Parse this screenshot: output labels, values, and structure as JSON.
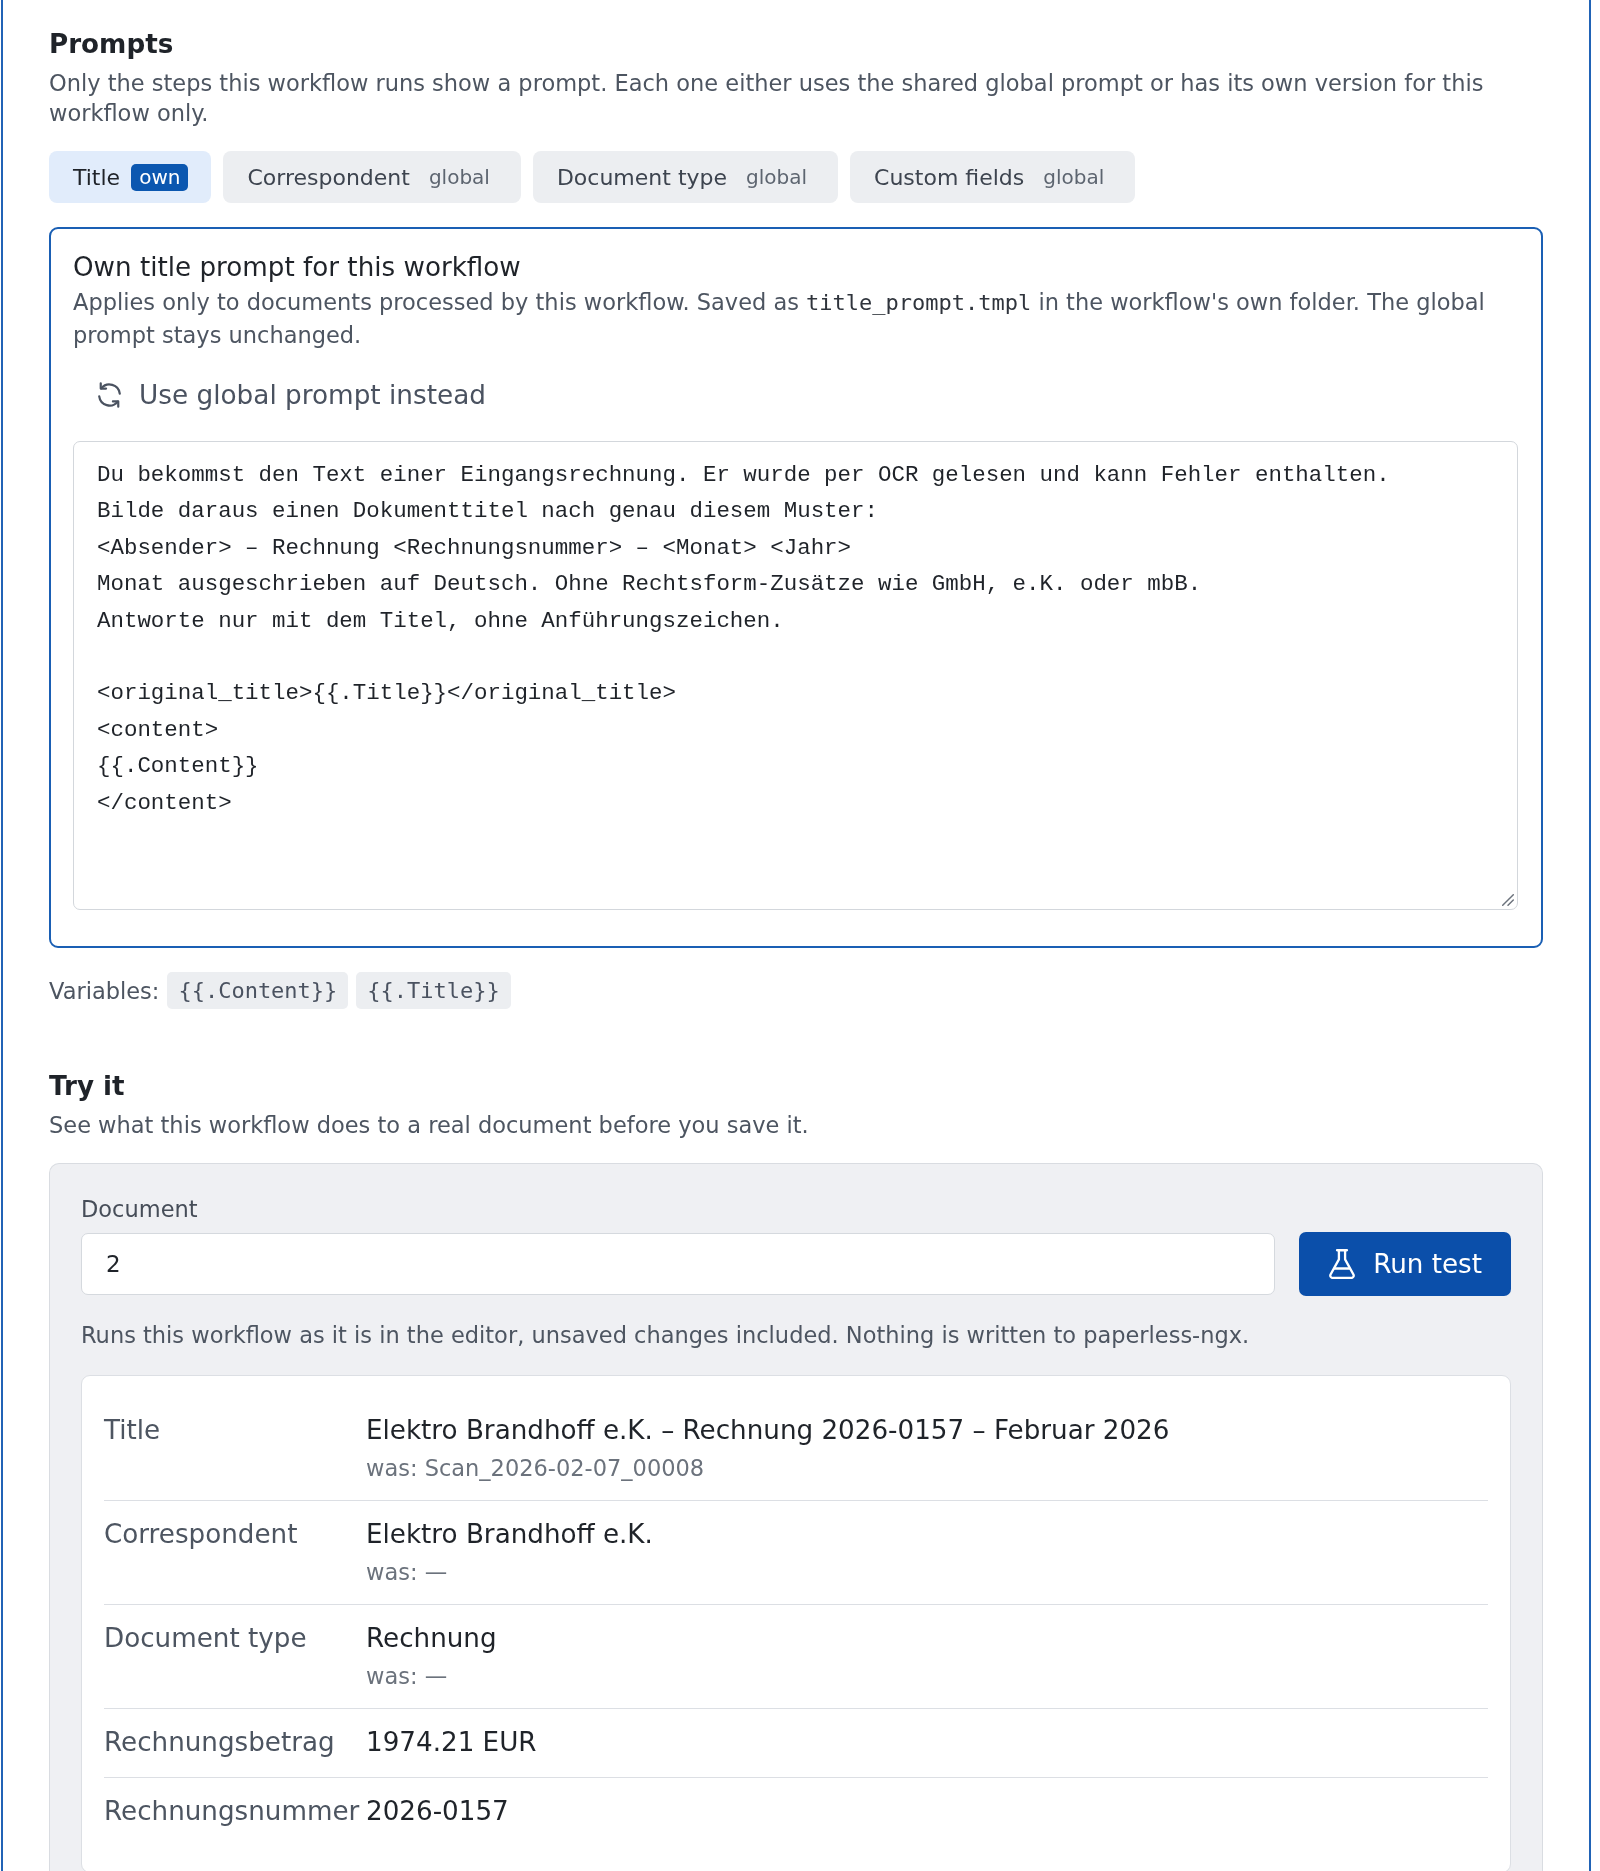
{
  "prompts": {
    "title": "Prompts",
    "description": "Only the steps this workflow runs show a prompt. Each one either uses the shared global prompt or has its own version for this workflow only.",
    "tabs": [
      {
        "label": "Title",
        "badge": "own",
        "own_prompt": true,
        "selected": true
      },
      {
        "label": "Correspondent",
        "badge": "global",
        "own_prompt": false,
        "selected": false
      },
      {
        "label": "Document type",
        "badge": "global",
        "own_prompt": false,
        "selected": false
      },
      {
        "label": "Custom fields",
        "badge": "global",
        "own_prompt": false,
        "selected": false
      }
    ],
    "editor": {
      "title": "Own title prompt for this workflow",
      "description": [
        {
          "kind": "text",
          "text": "Applies only to documents processed by this workflow. Saved as "
        },
        {
          "kind": "code",
          "text": "title_prompt.tmpl"
        },
        {
          "kind": "text",
          "text": " in the workflow's own folder. The global prompt stays unchanged."
        }
      ],
      "revert_button": "Use global prompt instead",
      "prompt_text": "Du bekommst den Text einer Eingangsrechnung. Er wurde per OCR gelesen und kann Fehler enthalten.\nBilde daraus einen Dokumenttitel nach genau diesem Muster:\n<Absender> – Rechnung <Rechnungsnummer> – <Monat> <Jahr>\nMonat ausgeschrieben auf Deutsch. Ohne Rechtsform-Zusätze wie GmbH, e.K. oder mbB.\nAntworte nur mit dem Titel, ohne Anführungszeichen.\n\n<original_title>{{.Title}}</original_title>\n<content>\n{{.Content}}\n</content>"
    },
    "variables": {
      "label": "Variables:",
      "items": [
        "{{.Content}}",
        "{{.Title}}"
      ]
    }
  },
  "try_it": {
    "title": "Try it",
    "description": "See what this workflow does to a real document before you save it.",
    "document": {
      "label": "Document",
      "value": "2"
    },
    "run_button": "Run test",
    "hint": "Runs this workflow as it is in the editor, unsaved changes included. Nothing is written to paperless-ngx.",
    "results": [
      {
        "field": "Title",
        "value": "Elektro Brandhoff e.K. – Rechnung 2026-0157 – Februar 2026",
        "previous": "was: Scan_2026-02-07_00008"
      },
      {
        "field": "Correspondent",
        "value": "Elektro Brandhoff e.K.",
        "previous": "was: —"
      },
      {
        "field": "Document type",
        "value": "Rechnung",
        "previous": "was: —"
      },
      {
        "field": "Rechnungsbetrag",
        "value": "1974.21 EUR"
      },
      {
        "field": "Rechnungsnummer",
        "value": "2026-0157"
      }
    ]
  }
}
